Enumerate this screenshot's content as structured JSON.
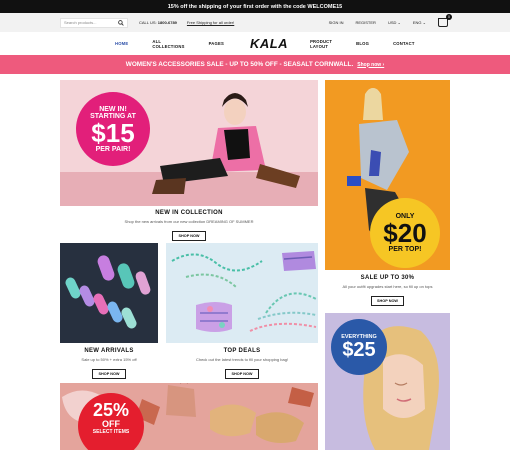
{
  "topbar": {
    "text": "15% off the shipping of your first order with the code WELCOME15"
  },
  "utilbar": {
    "search_placeholder": "Search products...",
    "call_label": "CALL US:",
    "phone": "1800-6789",
    "free_shipping": "Free Shipping for all order!",
    "sign_in": "SIGN IN",
    "register": "REGISTER",
    "currency": "USD ⌄",
    "language": "ENG ⌄",
    "cart_count": "0"
  },
  "nav": {
    "items": [
      "HOME",
      "ALL COLLECTIONS",
      "PAGES",
      "PRODUCT LAYOUT",
      "BLOG",
      "CONTACT"
    ],
    "logo": "KALA"
  },
  "promo": {
    "text": "WOMEN'S ACCESSORIES SALE - UP TO 50% OFF - SEASALT CORNWALL.",
    "link": "Shop now ›"
  },
  "tiles": {
    "new_in": {
      "badge": [
        "NEW IN!",
        "STARTING AT",
        "$15",
        "PER PAIR!"
      ],
      "title": "NEW IN COLLECTION",
      "subtitle": "Shop the new arrivals from our new collection DREAMING OF SUMMER",
      "button": "SHOP NOW"
    },
    "sale": {
      "badge": [
        "ONLY",
        "$20",
        "PER TOP!"
      ],
      "title": "SALE UP TO 30%",
      "subtitle": "All your outfit upgrades start here, so fill up on tops",
      "button": "SHOP NOW"
    },
    "arrivals": {
      "title": "NEW ARRIVALS",
      "subtitle": "Sale up to 50% + extra 15% off",
      "button": "SHOP NOW"
    },
    "deals": {
      "title": "TOP DEALS",
      "subtitle": "Check out the latest trends to fill your shopping bag!",
      "button": "SHOP NOW"
    },
    "everything": {
      "badge": [
        "EVERYTHING",
        "$25"
      ]
    },
    "off25": {
      "badge": [
        "25%",
        "OFF",
        "SELECT ITEMS"
      ]
    }
  },
  "colors": {
    "accent": "#ee5a7d",
    "nav_active": "#2c4fa8",
    "badge_yellow": "#f6c624",
    "badge_pink": "#e21f7a",
    "badge_blue": "#2a59a8",
    "badge_red": "#e41e2e"
  }
}
